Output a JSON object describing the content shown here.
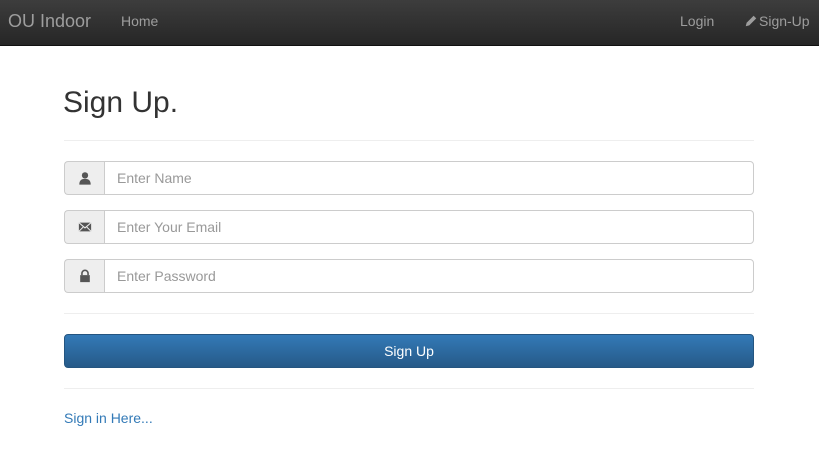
{
  "navbar": {
    "brand": "OU Indoor",
    "home": "Home",
    "login": "Login",
    "signup": "Sign-Up"
  },
  "form": {
    "title": "Sign Up.",
    "name_placeholder": "Enter Name",
    "email_placeholder": "Enter Your Email",
    "password_placeholder": "Enter Password",
    "submit_label": "Sign Up",
    "signin_link": "Sign in Here..."
  },
  "icons": {
    "name": "user-icon",
    "email": "envelope-icon",
    "password": "lock-icon",
    "signup": "pencil-icon"
  },
  "colors": {
    "navbar": "#2e2e2e",
    "primary": "#337ab7",
    "link": "#337ab7"
  }
}
